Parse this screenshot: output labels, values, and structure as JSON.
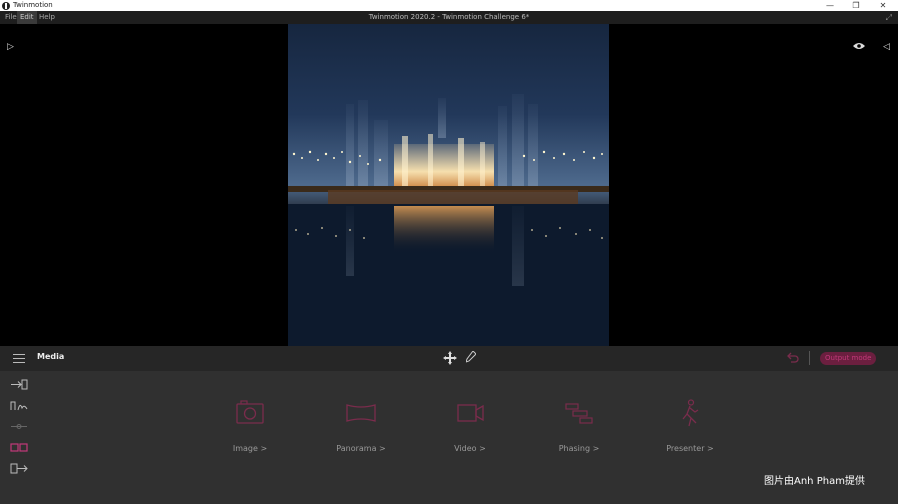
{
  "window": {
    "app_name": "Twinmotion",
    "doc_title": "Twinmotion 2020.2 - Twinmotion Challenge 6*",
    "controls": {
      "minimize": "—",
      "maximize": "❐",
      "close": "✕"
    }
  },
  "menu": [
    {
      "label": "File"
    },
    {
      "label": "Edit"
    },
    {
      "label": "Help"
    }
  ],
  "toolbar": {
    "title": "Media",
    "output_mode_label": "Output mode"
  },
  "media_items": [
    {
      "label": "Image",
      "icon": "camera-icon"
    },
    {
      "label": "Panorama",
      "icon": "panorama-icon"
    },
    {
      "label": "Video",
      "icon": "video-icon"
    },
    {
      "label": "Phasing",
      "icon": "phasing-icon"
    },
    {
      "label": "Presenter",
      "icon": "presenter-icon"
    }
  ],
  "chevron": ">",
  "watermark": "图片由Anh Pham提供",
  "colors": {
    "accent": "#c2397a",
    "accent_dim": "#6b1f3f",
    "icon_muted": "#7a2c4c"
  }
}
